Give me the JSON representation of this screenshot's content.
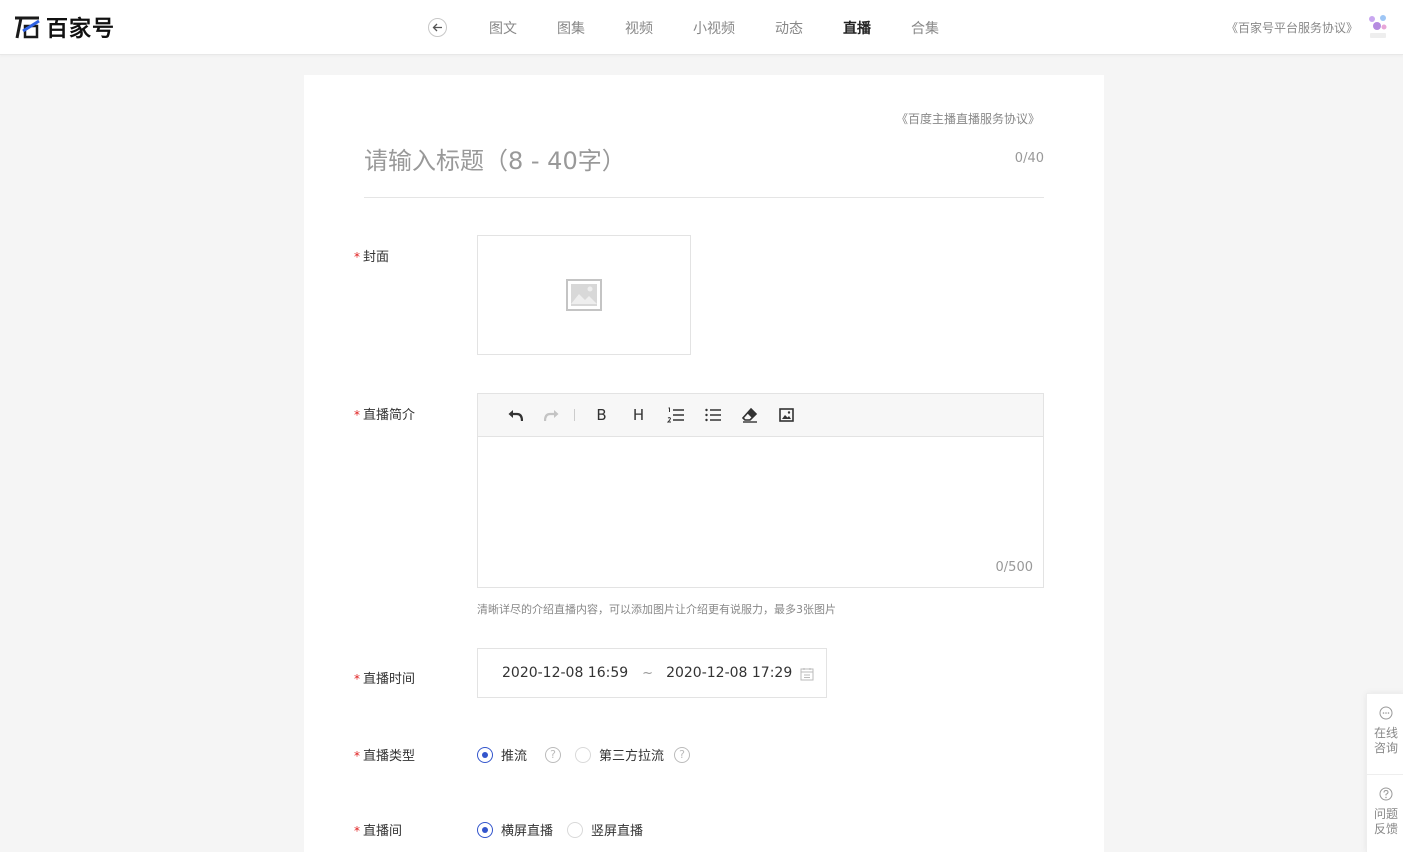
{
  "header": {
    "logo_text": "百家号",
    "nav": [
      "图文",
      "图集",
      "视频",
      "小视频",
      "动态",
      "直播",
      "合集"
    ],
    "active_nav": "直播",
    "agreement": "《百家号平台服务协议》",
    "icons": {
      "back": "arrow-left-icon",
      "logo": "baijiahao-logo-icon",
      "avatar": "user-avatar-icon"
    }
  },
  "form": {
    "agreement": "《百度主播直播服务协议》",
    "title_placeholder": "请输入标题（8 - 40字）",
    "title_count": "0/40",
    "required_mark": "*",
    "cover": {
      "label": "封面",
      "icon": "image-placeholder-icon"
    },
    "intro": {
      "label": "直播简介",
      "count": "0/500",
      "hint": "清晰详尽的介绍直播内容，可以添加图片让介绍更有说服力，最多3张图片",
      "toolbar": {
        "bold": "B",
        "heading": "H"
      }
    },
    "time": {
      "label": "直播时间",
      "start": "2020-12-08 16:59",
      "separator": "~",
      "end": "2020-12-08 17:29"
    },
    "type": {
      "label": "直播类型",
      "options": [
        "推流",
        "第三方拉流"
      ],
      "selected": "推流"
    },
    "room": {
      "label": "直播间",
      "options": [
        "横屏直播",
        "竖屏直播"
      ],
      "selected": "横屏直播"
    }
  },
  "float_panel": {
    "consult": "在线咨询",
    "feedback": "问题反馈"
  },
  "colors": {
    "accent": "#3355cc",
    "required": "#e02020"
  }
}
